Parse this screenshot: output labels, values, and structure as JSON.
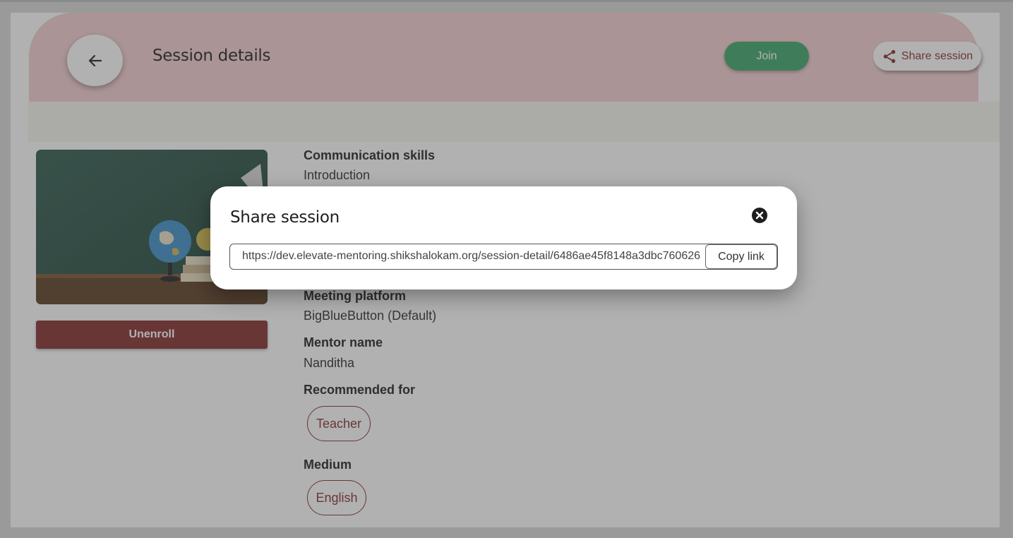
{
  "header": {
    "title": "Session details",
    "join_label": "Join",
    "share_label": "Share session"
  },
  "session": {
    "title": "Communication skills",
    "description": "Introduction",
    "unenroll_label": "Unenroll",
    "meeting_platform_label": "Meeting platform",
    "meeting_platform_value": "BigBlueButton (Default)",
    "mentor_label": "Mentor name",
    "mentor_value": "Nanditha",
    "recommended_label": "Recommended for",
    "recommended_chip": "Teacher",
    "medium_label": "Medium",
    "medium_chip": "English"
  },
  "modal": {
    "title": "Share session",
    "link": "https://dev.elevate-mentoring.shikshalokam.org/session-detail/6486ae45f8148a3dbc760626",
    "copy_label": "Copy link"
  },
  "colors": {
    "header_bg": "#f3cdd0",
    "brand": "#832b2b",
    "join": "#3ca56a"
  }
}
